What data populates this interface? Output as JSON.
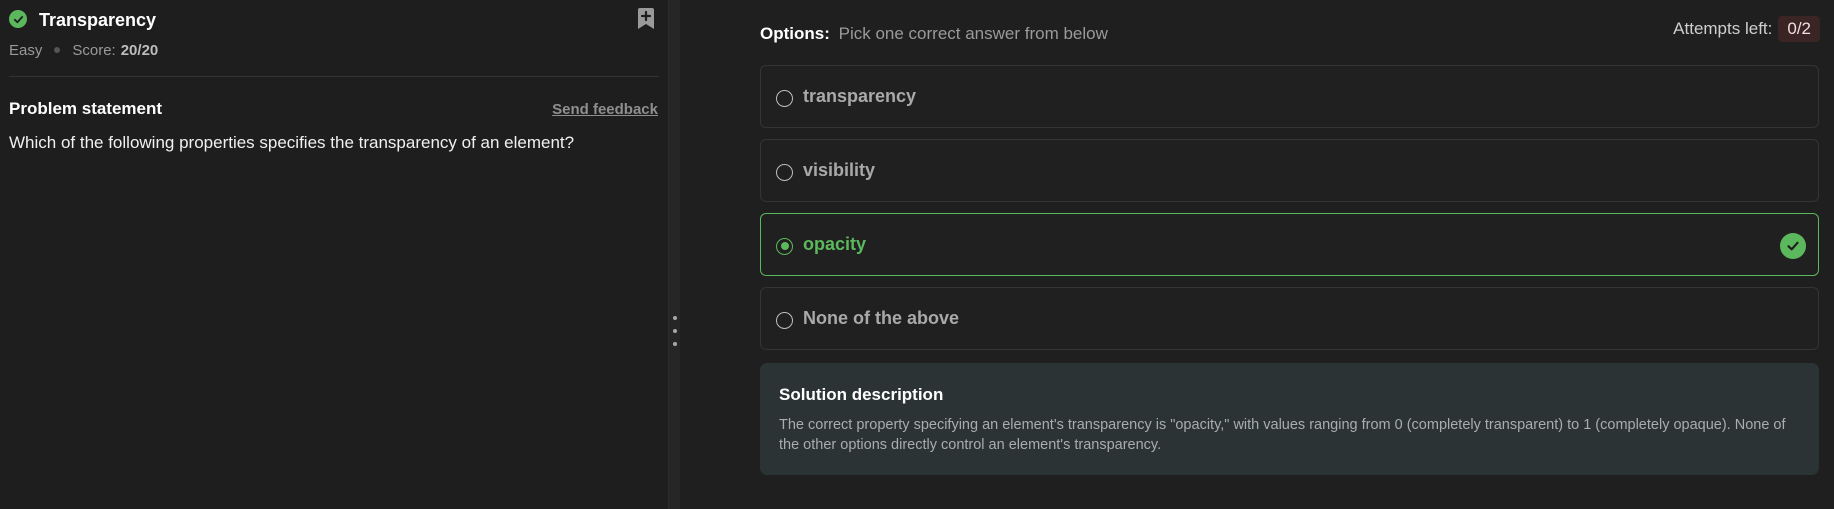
{
  "problem": {
    "title": "Transparency",
    "difficulty": "Easy",
    "score_label": "Score:",
    "score_value": "20/20",
    "statement_heading": "Problem statement",
    "feedback_link": "Send feedback",
    "question": "Which of the following properties specifies the transparency of an element?"
  },
  "options_panel": {
    "heading": "Options:",
    "subheading": "Pick one correct answer from below",
    "attempts_label": "Attempts left:",
    "attempts_value": "0/2",
    "options": [
      {
        "label": "transparency",
        "state": "unselected"
      },
      {
        "label": "visibility",
        "state": "unselected"
      },
      {
        "label": "opacity",
        "state": "correct-selected"
      },
      {
        "label": "None of the above",
        "state": "unselected"
      }
    ]
  },
  "solution": {
    "title": "Solution description",
    "text": "The correct property specifying an element's transparency is \"opacity,\" with values ranging from 0 (completely transparent) to 1 (completely opaque). None of the other options directly control an element's transparency."
  },
  "colors": {
    "success": "#5cb85c",
    "background": "#1e1e1e",
    "solution_bg": "#2b3335",
    "attempts_badge_bg": "#3a2424"
  },
  "icons": {
    "status": "check-circle-icon",
    "bookmark": "bookmark-plus-icon",
    "correct": "check-circle-icon",
    "splitter": "drag-handle-icon"
  }
}
